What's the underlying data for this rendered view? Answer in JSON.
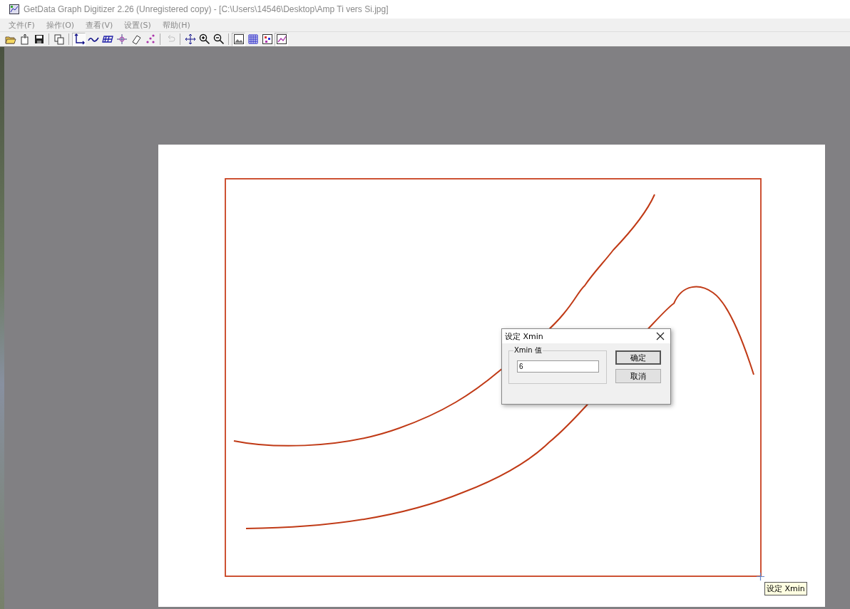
{
  "window": {
    "title": "GetData Graph Digitizer 2.26 (Unregistered copy) - [C:\\Users\\14546\\Desktop\\Amp Ti vers Si.jpg]"
  },
  "menu": [
    {
      "label": "文件(F)"
    },
    {
      "label": "操作(O)"
    },
    {
      "label": "查看(V)"
    },
    {
      "label": "设置(S)"
    },
    {
      "label": "帮助(H)"
    }
  ],
  "toolbar": [
    {
      "kind": "open",
      "pressed": false,
      "disabled": false
    },
    {
      "kind": "export",
      "pressed": false,
      "disabled": false
    },
    {
      "kind": "save",
      "pressed": false,
      "disabled": false
    },
    {
      "kind": "sep"
    },
    {
      "kind": "copy",
      "pressed": false,
      "disabled": false
    },
    {
      "kind": "sep"
    },
    {
      "kind": "axes",
      "pressed": true,
      "disabled": false
    },
    {
      "kind": "line",
      "pressed": false,
      "disabled": false
    },
    {
      "kind": "grid",
      "pressed": false,
      "disabled": false
    },
    {
      "kind": "point",
      "pressed": false,
      "disabled": false
    },
    {
      "kind": "eraser",
      "pressed": false,
      "disabled": false
    },
    {
      "kind": "dots",
      "pressed": false,
      "disabled": false
    },
    {
      "kind": "sep"
    },
    {
      "kind": "undo",
      "pressed": false,
      "disabled": true
    },
    {
      "kind": "sep"
    },
    {
      "kind": "pan",
      "pressed": false,
      "disabled": false
    },
    {
      "kind": "zoomin",
      "pressed": false,
      "disabled": false
    },
    {
      "kind": "zoomout",
      "pressed": false,
      "disabled": false
    },
    {
      "kind": "sep"
    },
    {
      "kind": "image",
      "pressed": true,
      "disabled": false
    },
    {
      "kind": "gridview",
      "pressed": false,
      "disabled": false
    },
    {
      "kind": "pointsview",
      "pressed": false,
      "disabled": false
    },
    {
      "kind": "chart",
      "pressed": true,
      "disabled": false
    }
  ],
  "dialog": {
    "title": "设定 Xmin",
    "group_label": "Xmin 值",
    "value": "6",
    "buttons": [
      {
        "label": "确定",
        "default": true
      },
      {
        "label": "取消",
        "default": false
      }
    ]
  },
  "tooltip": "设定 Xmin"
}
